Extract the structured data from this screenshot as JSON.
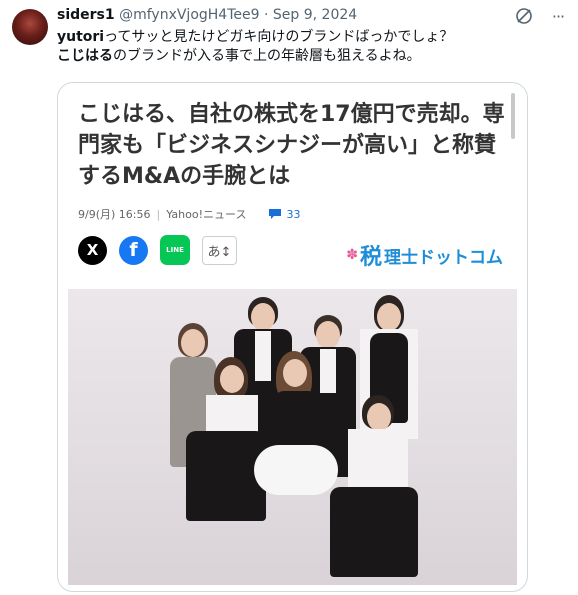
{
  "tweet": {
    "display_name": "siders1",
    "handle": "@mfynxVjogH4Tee9",
    "separator": "·",
    "date": "Sep 9, 2024",
    "line1_bold": "yutori",
    "line1_rest": "ってサッと見たけどガキ向けのブランドばっかでしょ？",
    "line2_bold": "こじはる",
    "line2_rest": "のブランドが入る事で上の年齢層も狙えるよね。"
  },
  "icons": {
    "grok": "grok-icon",
    "more": "more-icon",
    "more_glyph": "···"
  },
  "article": {
    "headline": "こじはる、自社の株式を17億円で売却。専門家も「ビジネスシナジーが高い」と称賛するM&Aの手腕とは",
    "date": "9/9(月) 16:56",
    "source": "Yahoo!ニュース",
    "comment_count": "33",
    "share_x": "X",
    "share_fb": "f",
    "share_line": "LINE",
    "font_size_label": "あ↕",
    "brand_tax": "税",
    "brand_rest": "理士ドットコム"
  },
  "colors": {
    "accent_blue": "#1a6ed8",
    "facebook": "#1877f2",
    "line_green": "#06c755",
    "brand_blue": "#1f8ed8"
  }
}
